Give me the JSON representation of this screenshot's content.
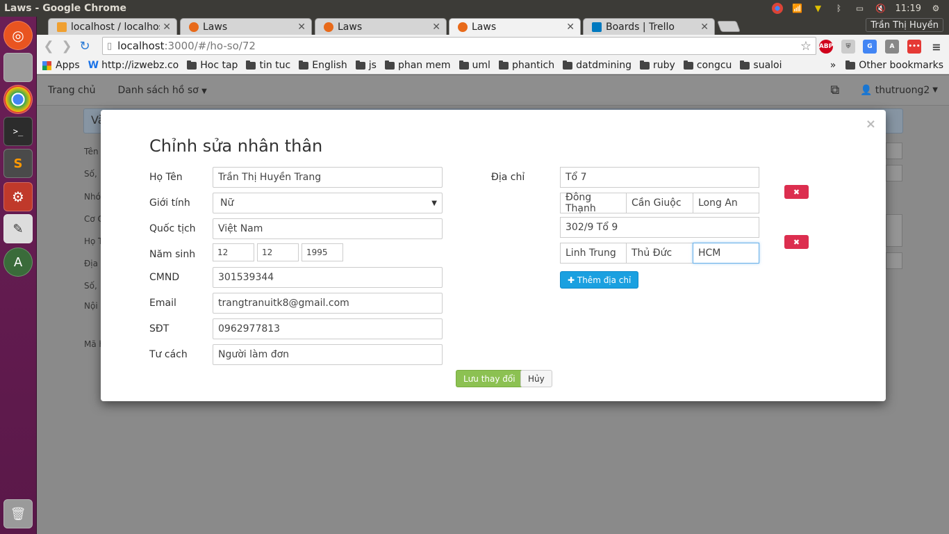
{
  "os": {
    "window_title": "Laws - Google Chrome",
    "clock": "11:19",
    "user_name": "Trần Thị Huyền"
  },
  "browser": {
    "tabs": [
      {
        "label": "localhost / localhost",
        "color": "#f0a030"
      },
      {
        "label": "Laws",
        "color": "#e86a1a"
      },
      {
        "label": "Laws",
        "color": "#e86a1a"
      },
      {
        "label": "Laws",
        "color": "#e86a1a"
      },
      {
        "label": "Boards | Trello",
        "color": "#0079bf"
      }
    ],
    "url_host": "localhost",
    "url_path": ":3000/#/ho-so/72",
    "bookmarks": [
      "Apps",
      "http://izwebz.co",
      "Hoc tap",
      "tin tuc",
      "English",
      "js",
      "phan mem",
      "uml",
      "phantich",
      "datdmining",
      "ruby",
      "congcu",
      "sualoi"
    ],
    "bookmarks_overflow": "»",
    "other_bookmarks": "Other bookmarks"
  },
  "app": {
    "nav_home": "Trang chủ",
    "nav_list": "Danh sách hồ sơ",
    "nav_user": "thutruong2",
    "bg_labels": [
      "Tên",
      "Số,",
      "Nhó",
      "Cơ C",
      "Họ T",
      "Địa",
      "Số,",
      "Nội",
      "Mã h"
    ],
    "bg_heading": "Và"
  },
  "modal": {
    "title": "Chỉnh sửa nhân thân",
    "close": "×",
    "labels": {
      "name": "Họ Tên",
      "gender": "Giới tính",
      "nationality": "Quốc tịch",
      "birth": "Năm sinh",
      "id": "CMND",
      "email": "Email",
      "phone": "SĐT",
      "role": "Tư cách",
      "address": "Địa chỉ"
    },
    "values": {
      "name": "Trần Thị Huyền Trang",
      "gender": "Nữ",
      "nationality": "Việt Nam",
      "birth_day": "12",
      "birth_month": "12",
      "birth_year": "1995",
      "id": "301539344",
      "email": "trangtranuitk8@gmail.com",
      "phone": "0962977813",
      "role": "Người làm đơn"
    },
    "addresses": [
      {
        "street": "Tổ 7",
        "ward": "Đông Thạnh",
        "district": "Cần Giuộc",
        "province": "Long An"
      },
      {
        "street": "302/9 Tổ 9",
        "ward": "Linh Trung",
        "district": "Thủ Đức",
        "province": "HCM"
      }
    ],
    "delete_icon": "✖",
    "add_address": "✚ Thêm địa chỉ",
    "save": "Lưu thay đổi",
    "cancel": "Hủy"
  }
}
